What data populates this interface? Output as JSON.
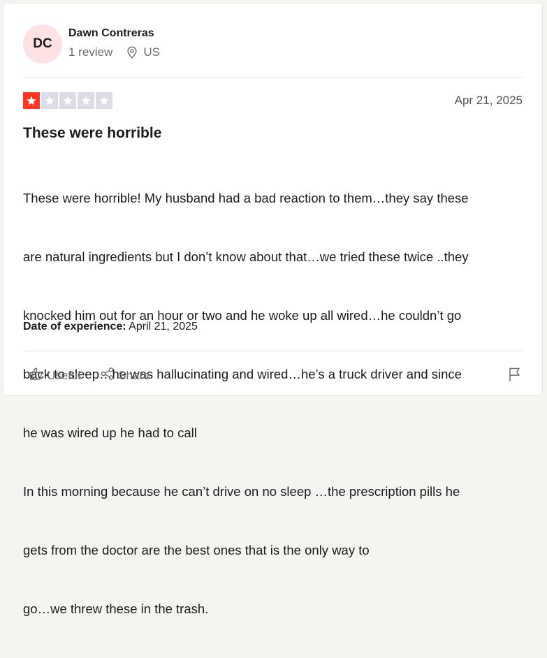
{
  "reviewer": {
    "initials": "DC",
    "name": "Dawn Contreras",
    "review_count": "1 review",
    "location": "US",
    "avatar_color": "#fde1e3"
  },
  "review": {
    "rating": 1,
    "max_rating": 5,
    "star_color": "#ff3722",
    "star_empty_color": "#dcdce6",
    "date": "Apr 21, 2025",
    "title": "These were horrible",
    "body_lines": [
      "These were horrible! My husband had a bad reaction to them…they say these",
      "are natural ingredients but I don’t know about that…we tried these twice ..they",
      "knocked him out for an hour or two and he woke up all wired…he couldn’t go",
      "back to sleep…he was hallucinating and wired…he’s a truck driver and since",
      "he was wired up he had to call",
      "In this morning because he can’t drive on no sleep …the prescription pills he",
      "gets from the doctor are the best ones that is the only way to",
      "go…we threw these in the trash."
    ],
    "experience_label": "Date of experience:",
    "experience_date": "April 21, 2025"
  },
  "actions": {
    "useful_label": "Useful",
    "useful_icon": "thumbs-up-icon",
    "share_label": "Share",
    "share_icon": "share-icon",
    "report_icon": "flag-icon"
  }
}
